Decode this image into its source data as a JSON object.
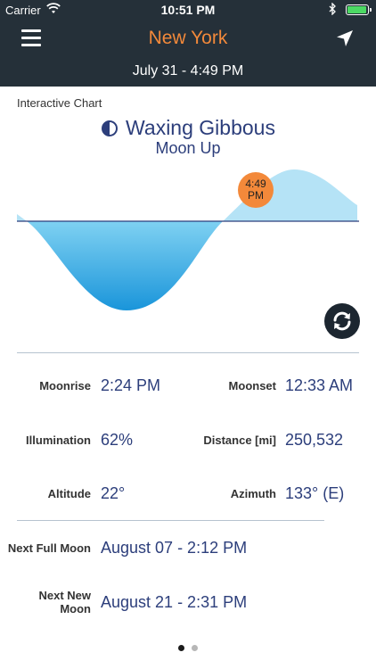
{
  "status_bar": {
    "carrier": "Carrier",
    "time": "10:51 PM"
  },
  "header": {
    "city": "New York",
    "datetime": "July 31 - 4:49 PM",
    "accent_color": "#f3893a",
    "bar_color": "#253039"
  },
  "chart_section": {
    "label": "Interactive Chart",
    "phase": "Waxing Gibbous",
    "moon_status": "Moon Up",
    "marker_time_line1": "4:49",
    "marker_time_line2": "PM"
  },
  "details": {
    "moonrise_label": "Moonrise",
    "moonrise_value": "2:24 PM",
    "moonset_label": "Moonset",
    "moonset_value": "12:33 AM",
    "illumination_label": "Illumination",
    "illumination_value": "62%",
    "distance_label": "Distance [mi]",
    "distance_value": "250,532",
    "altitude_label": "Altitude",
    "altitude_value": "22°",
    "azimuth_label": "Azimuth",
    "azimuth_value": "133° (E)"
  },
  "next_events": {
    "full_moon_label": "Next Full Moon",
    "full_moon_value": "August 07 - 2:12 PM",
    "new_moon_label_line1": "Next New",
    "new_moon_label_line2": "Moon",
    "new_moon_value": "August 21 - 2:31 PM"
  },
  "pager": {
    "page_count": 2,
    "active_index": 0
  }
}
